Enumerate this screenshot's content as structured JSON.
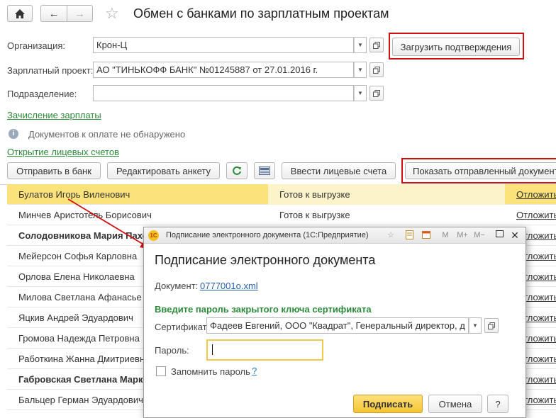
{
  "header": {
    "title": "Обмен с банками по зарплатным проектам"
  },
  "form": {
    "org_label": "Организация:",
    "org_value": "Крон-Ц",
    "project_label": "Зарплатный проект:",
    "project_value": "АО \"ТИНЬКОФФ БАНК\" №01245887 от 27.01.2016 г.",
    "dept_label": "Подразделение:",
    "dept_value": "",
    "load_button": "Загрузить подтверждения"
  },
  "links": {
    "salary": "Зачисление зарплаты",
    "info": "Документов к оплате не обнаружено",
    "accounts": "Открытие лицевых счетов"
  },
  "toolbar": {
    "send": "Отправить в банк",
    "edit": "Редактировать анкету",
    "enter": "Ввести лицевые счета",
    "show": "Показать отправленный документ"
  },
  "rows": [
    {
      "name": "Булатов Игорь Виленович",
      "status": "Готов к выгрузке",
      "action": "Отложить"
    },
    {
      "name": "Минчев Аристотель Борисович",
      "status": "Готов к выгрузке",
      "action": "Отложить"
    },
    {
      "name": "Солодовникова Мария Пахо",
      "status": "",
      "action": "Отложить"
    },
    {
      "name": "Мейерсон Софья Карловна",
      "status": "",
      "action": "Отложить"
    },
    {
      "name": "Орлова Елена Николаевна",
      "status": "",
      "action": "Отложить"
    },
    {
      "name": "Милова Светлана Афанасье",
      "status": "",
      "action": "Отложить"
    },
    {
      "name": "Яцкив Андрей Эдуардович",
      "status": "",
      "action": "Отложить"
    },
    {
      "name": "Громова Надежда Петровна",
      "status": "",
      "action": "Отложить"
    },
    {
      "name": "Работкина Жанна Дмитриевн",
      "status": "",
      "action": "Отложить"
    },
    {
      "name": "Габровская Светлана Марко",
      "status": "",
      "action": "Отложить"
    },
    {
      "name": "Бальцер Герман Эдуардович",
      "status": "",
      "action": "Отложить"
    }
  ],
  "dialog": {
    "window_title": "Подписание электронного документа  (1С:Предприятие)",
    "heading": "Подписание электронного документа",
    "doc_label": "Документ:",
    "doc_link": "0777001o.xml",
    "prompt": "Введите пароль закрытого ключа сертификата",
    "cert_label": "Сертификат:",
    "cert_value": "Фадеев Евгений, ООО \"Квадрат\", Генеральный директор, д",
    "pass_label": "Пароль:",
    "pass_value": "",
    "remember": "Запомнить пароль",
    "help_q": "?",
    "sign_button": "Подписать",
    "cancel_button": "Отмена",
    "help_button": "?",
    "tb_m": "M",
    "tb_mplus": "M+",
    "tb_mminus": "M−"
  },
  "colors": {
    "accent_yellow": "#fbe27a",
    "link_green": "#2d8a3a",
    "highlight_red": "#d01010"
  }
}
